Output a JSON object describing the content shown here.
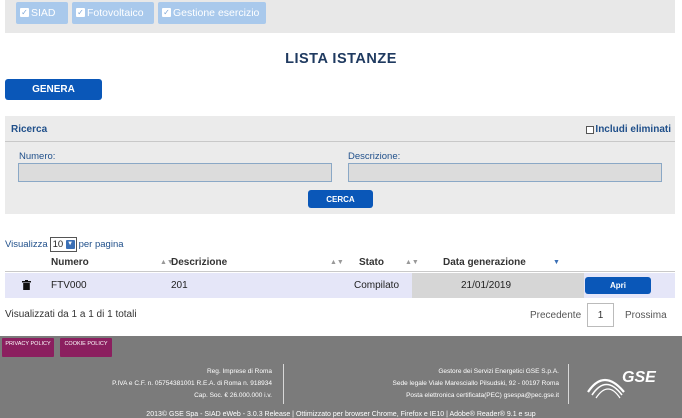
{
  "tabs": [
    {
      "label": "SIAD"
    },
    {
      "label": "Fotovoltaico"
    },
    {
      "label": "Gestione esercizio"
    }
  ],
  "page_title": "LISTA ISTANZE",
  "genera_label": "GENERA",
  "search": {
    "title": "Ricerca",
    "includi_label": "Includi eliminati",
    "numero_label": "Numero:",
    "numero_value": "",
    "descrizione_label": "Descrizione:",
    "descrizione_value": "",
    "cerca_label": "CERCA"
  },
  "page_size": {
    "prefix": "Visualizza",
    "value": "10",
    "suffix": "per pagina"
  },
  "table": {
    "headers": [
      "Numero",
      "Descrizione",
      "Stato",
      "Data generazione"
    ],
    "rows": [
      {
        "numero": "FTV000",
        "descrizione": "201",
        "stato": "Compilato",
        "data": "21/01/2019",
        "action": "Apri"
      }
    ]
  },
  "summary": "Visualizzati da 1 a 1 di 1 totali",
  "pagination": {
    "prev": "Precedente",
    "current": "1",
    "next": "Prossima"
  },
  "footer": {
    "privacy": "PRIVACY POLICY",
    "cookie": "COOKIE POLICY",
    "left_lines": [
      "Reg. Imprese di Roma",
      "P.IVA e C.F. n. 05754381001 R.E.A. di Roma n. 918934",
      "Cap. Soc. € 26.000.000 i.v."
    ],
    "right_lines": [
      "Gestore dei Servizi Energetici GSE S.p.A.",
      "Sede legale Viale Maresciallo Pilsudski, 92 - 00197 Roma",
      "Posta elettronica certificata(PEC) gsespa@pec.gse.it"
    ],
    "logo_text": "GSE",
    "copyright": "2013© GSE Spa - SIAD eWeb - 3.0.3 Release | Ottimizzato per browser Chrome, Firefox e IE10 | Adobe® Reader® 9.1 e sup"
  },
  "colors": {
    "primary_button": "#0a57b8",
    "tab_bg": "#a9c9ec",
    "title": "#1f3a60",
    "footer_bg": "#7b7b7b",
    "policy_bg": "#8b1f5f"
  }
}
